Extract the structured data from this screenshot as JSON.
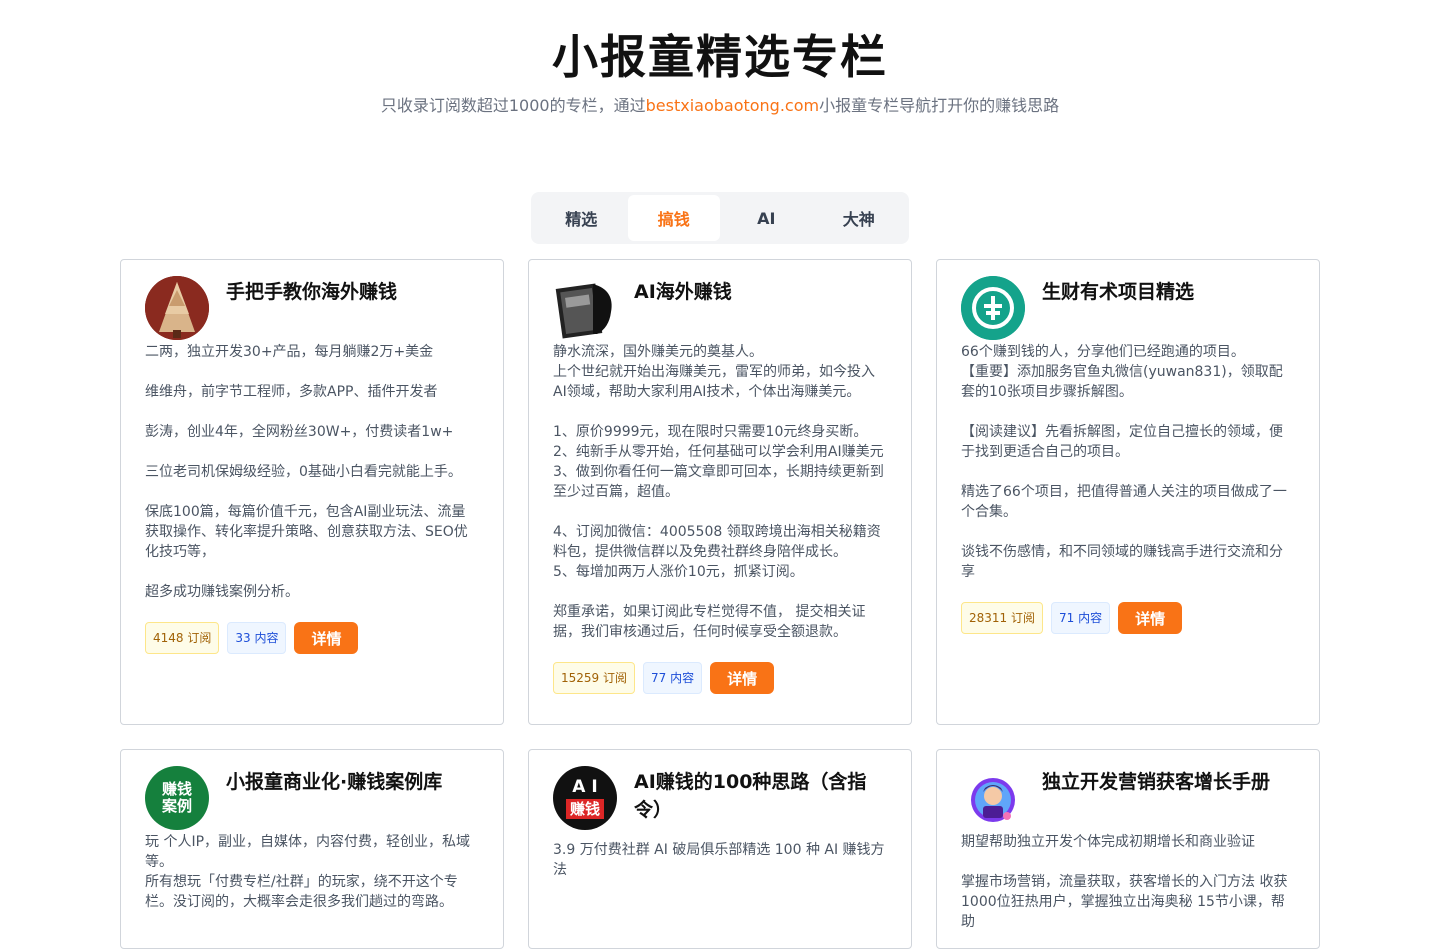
{
  "header": {
    "title": "小报童精选专栏",
    "subtitle_pre": "只收录订阅数超过1000的专栏，通过",
    "subtitle_link": "bestxiaobaotong.com",
    "subtitle_post": "小报童专栏导航打开你的赚钱思路"
  },
  "tabs": [
    {
      "label": "精选"
    },
    {
      "label": "搞钱"
    },
    {
      "label": "AI"
    },
    {
      "label": "大神"
    }
  ],
  "active_tab": "搞钱",
  "colors": {
    "accent": "#f97316",
    "subs_badge": "#a16207",
    "posts_badge": "#1d4ed8"
  },
  "cards": [
    {
      "title": "手把手教你海外赚钱",
      "avatar_icon": "christmas-tree-avatar",
      "description": "二两，独立开发30+产品，每月躺赚2万+美金\n\n维维舟，前字节工程师，多款APP、插件开发者\n\n彭涛，创业4年，全网粉丝30W+，付费读者1w+\n\n三位老司机保姆级经验，0基础小白看完就能上手。\n\n保底100篇，每篇价值千元，包含AI副业玩法、流量获取操作、转化率提升策略、创意获取方法、SEO优化技巧等，\n\n超多成功赚钱案例分析。",
      "subs": "4148 订阅",
      "posts": "33 内容",
      "button": "详情"
    },
    {
      "title": "AI海外赚钱",
      "avatar_icon": "money-head-avatar",
      "description": "静水流深，国外赚美元的奠基人。\n上个世纪就开始出海赚美元，雷军的师弟，如今投入AI领域，帮助大家利用AI技术，个体出海赚美元。\n\n1、原价9999元，现在限时只需要10元终身买断。\n2、纯新手从零开始，任何基础可以学会利用AI赚美元\n3、做到你看任何一篇文章即可回本，长期持续更新到至少过百篇，超值。\n\n4、订阅加微信：4005508 领取跨境出海相关秘籍资料包，提供微信群以及免费社群终身陪伴成长。\n5、每增加两万人涨价10元，抓紧订阅。\n\n郑重承诺，如果订阅此专栏觉得不值， 提交相关证据，我们审核通过后，任何时候享受全额退款。",
      "subs": "15259 订阅",
      "posts": "77 内容",
      "button": "详情"
    },
    {
      "title": "生财有术项目精选",
      "avatar_icon": "yuan-coin-avatar",
      "description": "66个赚到钱的人，分享他们已经跑通的项目。\n【重要】添加服务官鱼丸微信(yuwan831)，领取配套的10张项目步骤拆解图。\n\n【阅读建议】先看拆解图，定位自己擅长的领域，便于找到更适合自己的项目。\n\n精选了66个项目，把值得普通人关注的项目做成了一个合集。\n\n谈钱不伤感情，和不同领域的赚钱高手进行交流和分享",
      "subs": "28311 订阅",
      "posts": "71 内容",
      "button": "详情"
    },
    {
      "title": "小报童商业化·赚钱案例库",
      "avatar_text": "赚钱\n案例",
      "description": "玩 个人IP，副业，自媒体，内容付费，轻创业，私域等。\n所有想玩「付费专栏/社群」的玩家，绕不开这个专栏。没订阅的，大概率会走很多我们趟过的弯路。"
    },
    {
      "title": "AI赚钱的100种思路（含指令）",
      "avatar_text_top": "A I",
      "avatar_text_bottom": "赚钱",
      "description": "3.9 万付费社群 AI 破局俱乐部精选 100 种 AI 赚钱方法"
    },
    {
      "title": "独立开发营销获客增长手册",
      "avatar_icon": "developer-avatar",
      "description": "期望帮助独立开发个体完成初期增长和商业验证\n\n掌握市场营销，流量获取，获客增长的入门方法 收获1000位狂热用户，掌握独立出海奥秘 15节小课，帮助"
    }
  ]
}
